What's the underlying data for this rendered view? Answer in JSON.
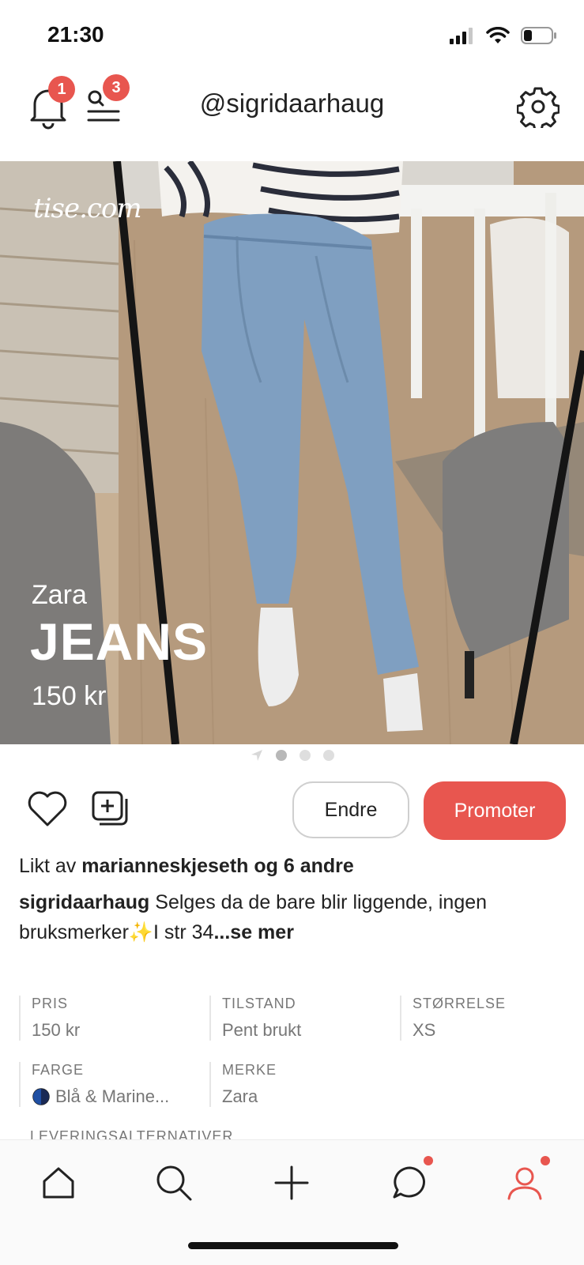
{
  "status_bar": {
    "time": "21:30"
  },
  "header": {
    "notifications_count": "1",
    "search_list_count": "3",
    "title": "@sigridaarhaug"
  },
  "photo": {
    "watermark": "tise.com",
    "overlay_brand": "Zara",
    "overlay_title": "JEANS",
    "overlay_price": "150 kr",
    "page_indicator": {
      "total": 3,
      "current": 1
    }
  },
  "actions": {
    "edit_label": "Endre",
    "promote_label": "Promoter"
  },
  "likes": {
    "prefix": "Likt av",
    "user": "marianneskjeseth",
    "suffix": "og 6 andre"
  },
  "caption": {
    "user": "sigridaarhaug",
    "text_line1": "Selges da de bare blir liggende, ingen",
    "text_line2": "bruksmerker✨I str 34",
    "more": "...se mer"
  },
  "details": [
    {
      "label": "PRIS",
      "value": "150 kr"
    },
    {
      "label": "TILSTAND",
      "value": "Pent brukt"
    },
    {
      "label": "STØRRELSE",
      "value": "XS"
    },
    {
      "label": "FARGE",
      "value": "Blå & Marine..."
    },
    {
      "label": "MERKE",
      "value": "Zara"
    }
  ],
  "delivery_label": "LEVERINGSALTERNATIVER",
  "colors": {
    "accent": "#e8564f",
    "text": "#222222",
    "muted": "#777777",
    "color_swatch_blue": "#1f4fa3"
  },
  "bottom_nav": {
    "items": [
      "home-icon",
      "search-icon",
      "plus-icon",
      "chat-icon",
      "profile-icon"
    ],
    "active": "profile-icon"
  }
}
